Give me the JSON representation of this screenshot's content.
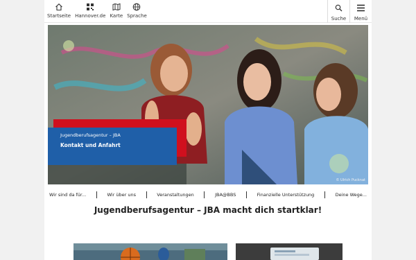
{
  "header": {
    "nav_left": [
      {
        "label": "Startseite",
        "icon": "home-icon"
      },
      {
        "label": "Hannover.de",
        "icon": "qr-logo-icon"
      },
      {
        "label": "Karte",
        "icon": "map-icon"
      },
      {
        "label": "Sprache",
        "icon": "globe-icon"
      }
    ],
    "search_label": "Suche",
    "menu_label": "Menü"
  },
  "hero": {
    "kicker": "Jugendberufsagentur – JBA",
    "link": "Kontakt und Anfahrt",
    "credit": "© Ulrich Pucknat"
  },
  "subnav": [
    "Wir sind da für...",
    "Wir über uns",
    "Veranstaltungen",
    "JBA@BBS",
    "Finanzielle Unterstützung",
    "Deine Wege..."
  ],
  "headline": "Jugendberufsagentur – JBA macht dich startklar!",
  "colors": {
    "caption_blue": "#1f5fa8",
    "caption_red": "#d0101e",
    "page_bg": "#f1f1f1"
  }
}
